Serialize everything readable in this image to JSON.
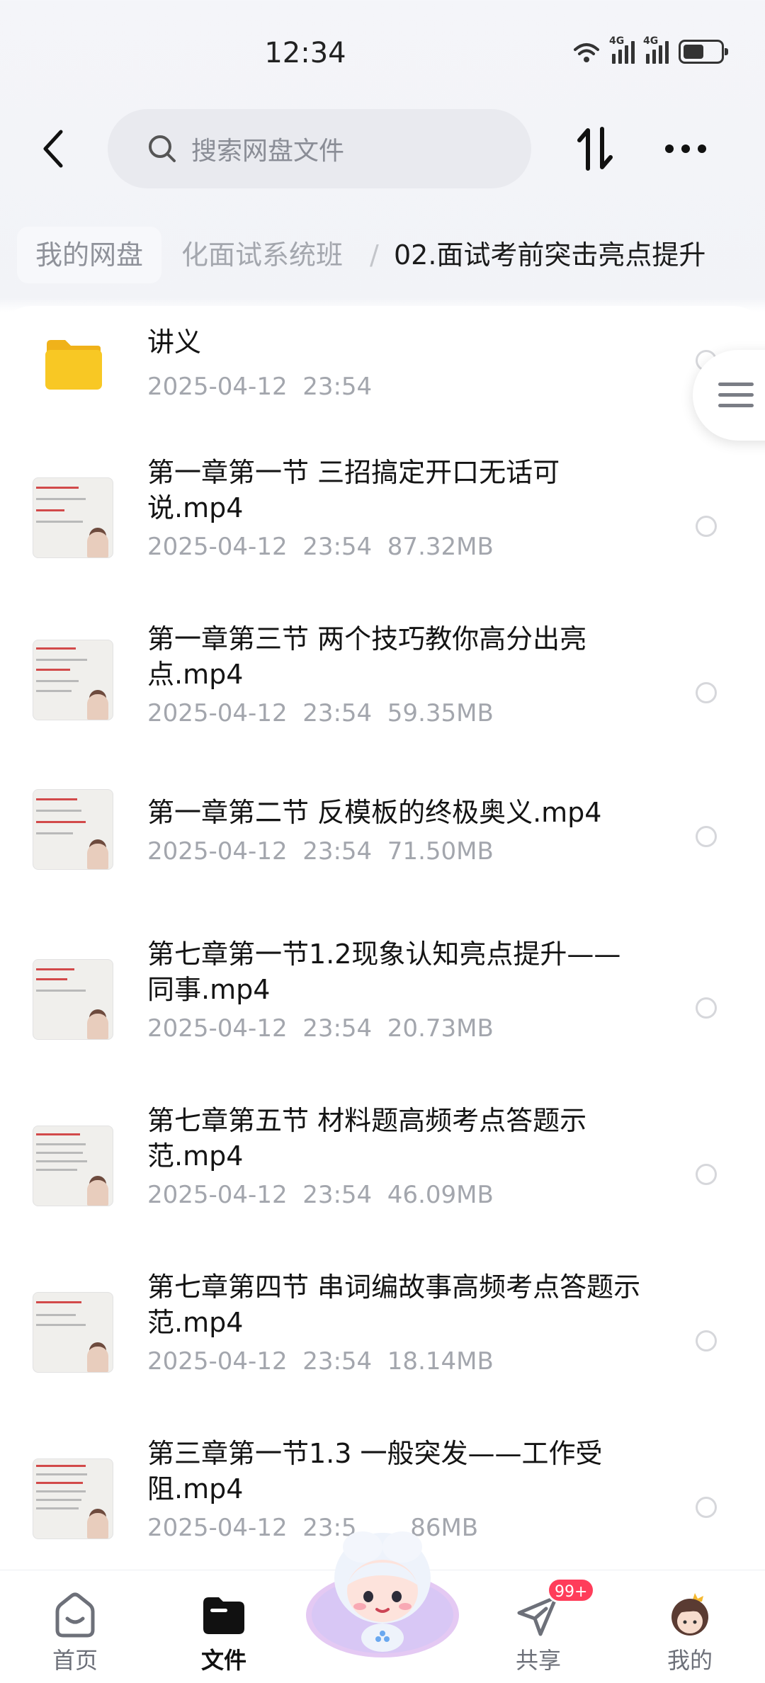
{
  "status_bar": {
    "time": "12:34",
    "signal_label": "4G"
  },
  "header": {
    "search_placeholder": "搜索网盘文件"
  },
  "breadcrumb": {
    "root": "我的网盘",
    "middle": "化面试系统班",
    "separator": "/",
    "current": "02.面试考前突击亮点提升"
  },
  "folder": {
    "name": "讲义",
    "meta": "2025-04-12  23:54"
  },
  "files": [
    {
      "name": "第一章第一节 三招搞定开口无话可说.mp4",
      "meta": "2025-04-12  23:54  87.32MB"
    },
    {
      "name": "第一章第三节 两个技巧教你高分出亮点.mp4",
      "meta": "2025-04-12  23:54  59.35MB"
    },
    {
      "name": "第一章第二节 反模板的终极奥义.mp4",
      "meta": "2025-04-12  23:54  71.50MB"
    },
    {
      "name": "第七章第一节1.2现象认知亮点提升——同事.mp4",
      "meta": "2025-04-12  23:54  20.73MB"
    },
    {
      "name": "第七章第五节 材料题高频考点答题示范.mp4",
      "meta": "2025-04-12  23:54  46.09MB"
    },
    {
      "name": "第七章第四节 串词编故事高频考点答题示范.mp4",
      "meta": "2025-04-12  23:54  18.14MB"
    },
    {
      "name": "第三章第一节1.3 一般突发——工作受阻.mp4",
      "meta": "2025-04-12  23:5      .86MB"
    }
  ],
  "nav": {
    "home": "首页",
    "files": "文件",
    "share": "共享",
    "share_badge": "99+",
    "mine": "我的"
  },
  "colors": {
    "accent": "#111111",
    "badge": "#ff3d5a",
    "folder": "#f8c824",
    "thumb_title": "#d24a4a"
  }
}
